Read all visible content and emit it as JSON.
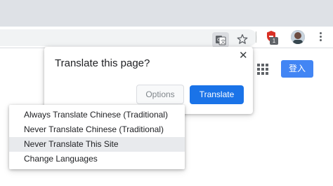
{
  "toolbar": {
    "extension_badge": "1"
  },
  "page": {
    "login_label": "登入"
  },
  "translate_bubble": {
    "title": "Translate this page?",
    "close_glyph": "✕",
    "options_label": "Options",
    "translate_label": "Translate"
  },
  "options_menu": {
    "items": [
      {
        "label": "Always Translate Chinese (Traditional)",
        "highlighted": false
      },
      {
        "label": "Never Translate Chinese (Traditional)",
        "highlighted": false
      },
      {
        "label": "Never Translate This Site",
        "highlighted": true
      },
      {
        "label": "Change Languages",
        "highlighted": false
      }
    ]
  },
  "colors": {
    "accent": "#1a73e8",
    "login_button": "#4285f4",
    "tabstrip": "#dee1e6",
    "extension_red": "#d93025"
  }
}
